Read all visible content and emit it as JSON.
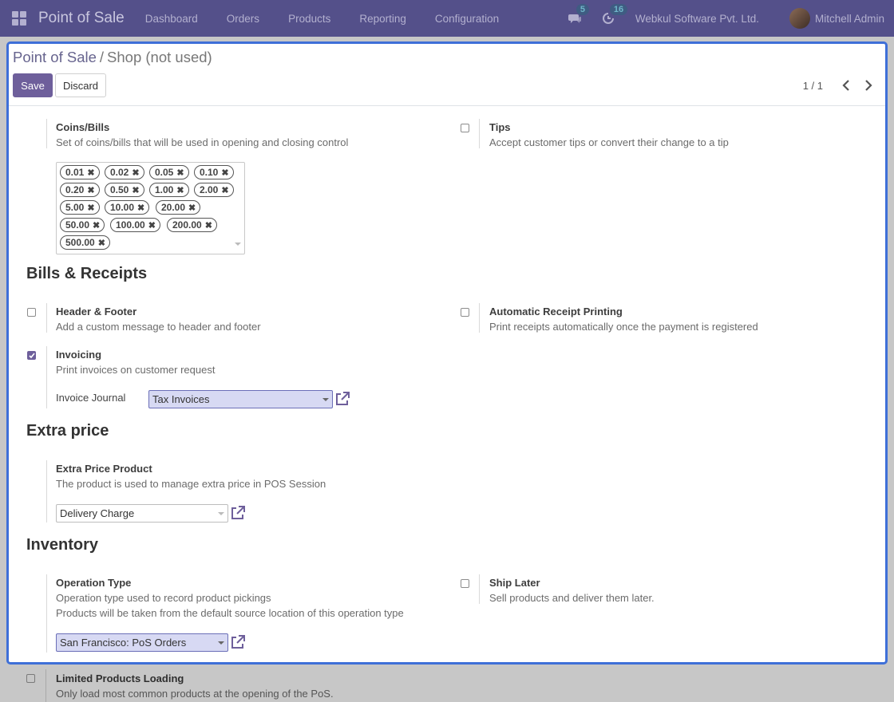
{
  "navbar": {
    "app_name": "Point of Sale",
    "menu": [
      "Dashboard",
      "Orders",
      "Products",
      "Reporting",
      "Configuration"
    ],
    "messages_count": "5",
    "activities_count": "16",
    "company": "Webkul Software Pvt. Ltd.",
    "user": "Mitchell Admin"
  },
  "control_panel": {
    "breadcrumb_root": "Point of Sale",
    "breadcrumb_sep": "/",
    "breadcrumb_current": "Shop (not used)",
    "save_label": "Save",
    "discard_label": "Discard",
    "pager": "1 / 1"
  },
  "coins": {
    "title": "Coins/Bills",
    "desc": "Set of coins/bills that will be used in opening and closing control",
    "values": [
      "0.01",
      "0.02",
      "0.05",
      "0.10",
      "0.20",
      "0.50",
      "1.00",
      "2.00",
      "5.00",
      "10.00",
      "20.00",
      "50.00",
      "100.00",
      "200.00",
      "500.00"
    ]
  },
  "tips": {
    "title": "Tips",
    "desc": "Accept customer tips or convert their change to a tip",
    "checked": false
  },
  "bills_receipts": {
    "heading": "Bills & Receipts",
    "header_footer": {
      "title": "Header & Footer",
      "desc": "Add a custom message to header and footer",
      "checked": false
    },
    "auto_print": {
      "title": "Automatic Receipt Printing",
      "desc": "Print receipts automatically once the payment is registered",
      "checked": false
    },
    "invoicing": {
      "title": "Invoicing",
      "desc": "Print invoices on customer request",
      "checked": true,
      "journal_label": "Invoice Journal",
      "journal_value": "Tax Invoices"
    }
  },
  "extra_price": {
    "heading": "Extra price",
    "title": "Extra Price Product",
    "desc": "The product is used to manage extra price in POS Session",
    "value": "Delivery Charge"
  },
  "inventory": {
    "heading": "Inventory",
    "operation_type": {
      "title": "Operation Type",
      "desc1": "Operation type used to record product pickings",
      "desc2": "Products will be taken from the default source location of this operation type",
      "value": "San Francisco: PoS Orders"
    },
    "ship_later": {
      "title": "Ship Later",
      "desc": "Sell products and deliver them later.",
      "checked": false
    }
  },
  "limited_loading": {
    "title": "Limited Products Loading",
    "desc": "Only load most common products at the opening of the PoS.",
    "checked": false
  },
  "colors": {
    "navbar": "#54508a",
    "primary": "#6e5f9b",
    "focus_border": "#3e6fd8"
  }
}
